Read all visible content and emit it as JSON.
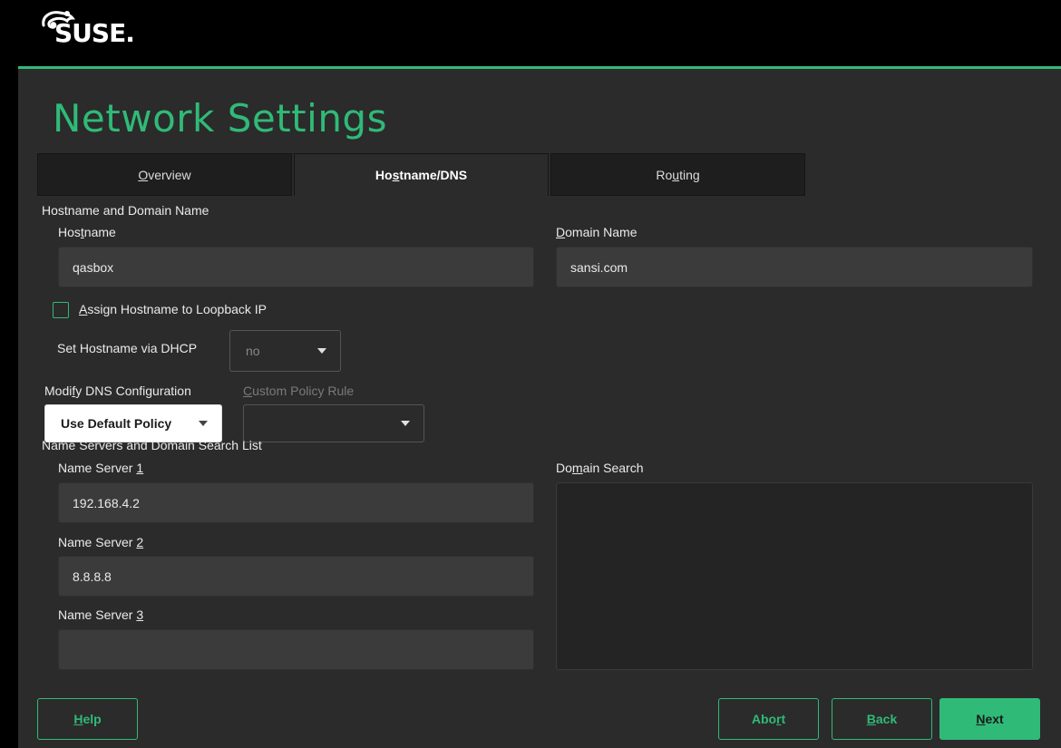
{
  "brand": {
    "logo_text": "SUSE.",
    "accent": "#30ba78"
  },
  "page": {
    "title": "Network Settings"
  },
  "tabs": [
    {
      "label_pre": "",
      "label_u": "O",
      "label_post": "verview",
      "active": false
    },
    {
      "label_pre": "Ho",
      "label_u": "s",
      "label_post": "tname/DNS",
      "active": true
    },
    {
      "label_pre": "Ro",
      "label_u": "u",
      "label_post": "ting",
      "active": false
    }
  ],
  "hostname_section": {
    "heading": "Hostname and Domain Name",
    "hostname_label_pre": "Hos",
    "hostname_label_u": "t",
    "hostname_label_post": "name",
    "hostname_value": "qasbox",
    "domain_label_pre": "",
    "domain_label_u": "D",
    "domain_label_post": "omain Name",
    "domain_value": "sansi.com",
    "loopback_label_pre": "",
    "loopback_label_u": "A",
    "loopback_label_post": "ssign Hostname to Loopback IP",
    "loopback_checked": false,
    "dhcp_label": "Set Hostname via DHCP",
    "dhcp_value": "no",
    "dns_label_pre": "Modi",
    "dns_label_u": "f",
    "dns_label_post": "y DNS Configuration",
    "dns_value": "Use Default Policy",
    "policy_label_pre": "",
    "policy_label_u": "C",
    "policy_label_post": "ustom Policy Rule",
    "policy_value": ""
  },
  "ns_section": {
    "heading": "Name Servers and Domain Search List",
    "ns1_label_pre": "Name Server ",
    "ns1_label_u": "1",
    "ns1_value": "192.168.4.2",
    "ns2_label_pre": "Name Server ",
    "ns2_label_u": "2",
    "ns2_value": "8.8.8.8",
    "ns3_label_pre": "Name Server ",
    "ns3_label_u": "3",
    "ns3_value": "",
    "search_label_pre": "Do",
    "search_label_u": "m",
    "search_label_post": "ain Search",
    "search_value": ""
  },
  "buttons": {
    "help_u": "H",
    "help_post": "elp",
    "abort_pre": "Abo",
    "abort_u": "r",
    "abort_post": "t",
    "back_u": "B",
    "back_post": "ack",
    "next_u": "N",
    "next_post": "ext"
  }
}
